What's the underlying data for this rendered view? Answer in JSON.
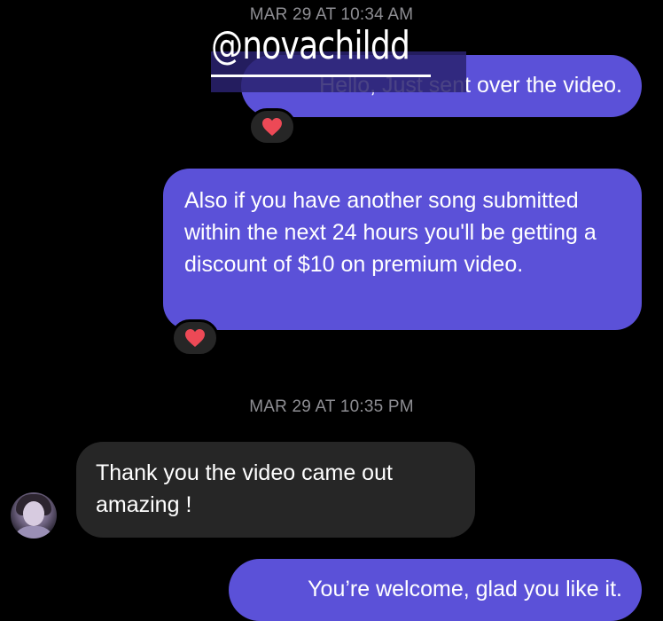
{
  "timestamps": {
    "first": "MAR 29 AT 10:34 AM",
    "second": "MAR 29 AT 10:35 PM"
  },
  "overlay": {
    "handle": "@novachildd"
  },
  "messages": [
    {
      "sender": "me",
      "text": "Hello, Just sent over the video.",
      "reaction": "heart-icon"
    },
    {
      "sender": "me",
      "text": "Also if you have another song submitted within the next 24 hours you'll be getting a discount of $10 on premium video.",
      "reaction": "heart-icon"
    },
    {
      "sender": "other",
      "text": "Thank you the video came out amazing !"
    },
    {
      "sender": "me",
      "text": "You’re welcome, glad you like it."
    }
  ],
  "colors": {
    "background": "#000000",
    "outgoing_bubble": "#5b51d8",
    "incoming_bubble": "#262626",
    "timestamp": "#8e8e93",
    "heart": "#ed4956"
  }
}
